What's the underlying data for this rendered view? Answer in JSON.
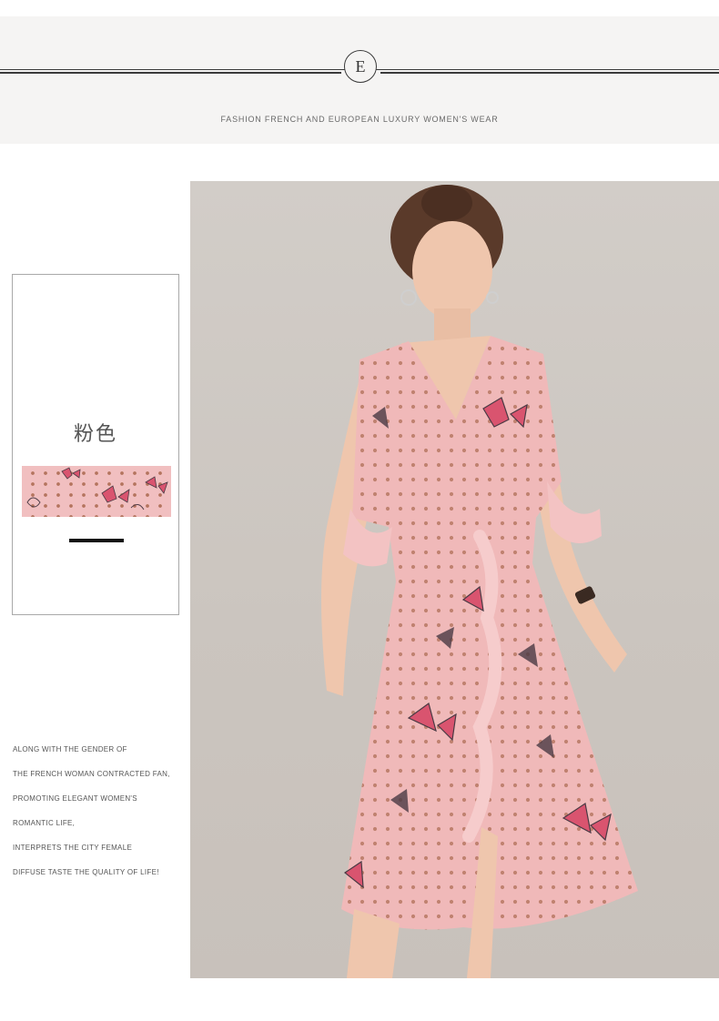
{
  "header": {
    "logo_letter": "E",
    "tagline": "FASHION FRENCH AND EUROPEAN LUXURY WOMEN'S WEAR"
  },
  "swatch": {
    "color_name": "粉色",
    "colors": {
      "fabric_pink": "#f1bfc0",
      "butterfly_pink": "#d9546f",
      "butterfly_dark": "#4a3a44",
      "dot_brown": "#b4745e"
    }
  },
  "photo": {
    "icon": "model-photo",
    "colors": {
      "backdrop": "#cfc9c3",
      "dress": "#f0b9b9",
      "skin": "#efc6ad",
      "hair": "#5a3a2a"
    }
  },
  "description": {
    "lines": [
      "ALONG WITH THE GENDER OF",
      "THE FRENCH WOMAN CONTRACTED FAN,",
      "PROMOTING ELEGANT WOMEN'S",
      "ROMANTIC LIFE,",
      "INTERPRETS THE CITY FEMALE",
      "DIFFUSE TASTE THE QUALITY OF LIFE!"
    ]
  }
}
